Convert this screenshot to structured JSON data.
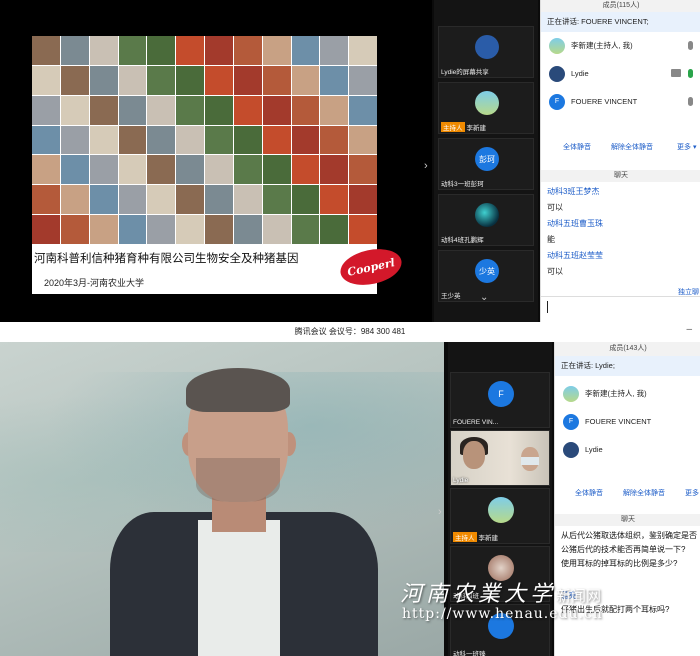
{
  "meeting": {
    "title": "腾讯会议 会议号：984 300 481"
  },
  "top": {
    "slide": {
      "title": "河南科普利信种猪育种有限公司生物安全及种猪基因",
      "date": "2020年3月-河南农业大学",
      "logo_text": "Cooperl",
      "mosaic_colors": [
        "#8a6a52",
        "#b45a3a",
        "#c9c0b4",
        "#6d8fa8",
        "#4a6b3a",
        "#d6cbb8",
        "#a33a2c",
        "#7b8a92",
        "#c8a184",
        "#5a7a4a",
        "#9a9fa6",
        "#c44c2c"
      ]
    },
    "video_tiles": [
      {
        "avatar": "",
        "caption": "Lydie的屏幕共享",
        "host": ""
      },
      {
        "avatar": "",
        "caption": "李新建",
        "host": "主持人"
      },
      {
        "avatar": "彭珂",
        "caption": "动科3一班彭珂",
        "host": ""
      },
      {
        "avatar": "",
        "caption": "动科4班孔鹏辉",
        "host": ""
      },
      {
        "avatar": "少英",
        "caption": "王少英",
        "host": ""
      }
    ],
    "members_panel": {
      "header": "成员(115人)",
      "speaking": "正在讲话: FOUERE VINCENT;",
      "members": [
        {
          "avatar": "",
          "name": "李新建(主持人, 我)"
        },
        {
          "avatar": "",
          "name": "Lydie"
        },
        {
          "avatar": "F",
          "name": "FOUERE VINCENT"
        }
      ],
      "buttons": {
        "mute_all": "全体静音",
        "unmute_all": "解除全体静音",
        "more": "更多 ▾"
      }
    },
    "chat": {
      "header": "聊天",
      "lines": [
        {
          "text": "动科3班王梦杰",
          "sender": true
        },
        {
          "text": "可以",
          "sender": false
        },
        {
          "text": "动科五班曹玉珠",
          "sender": true
        },
        {
          "text": "能",
          "sender": false
        },
        {
          "text": "动科五班赵莹莹",
          "sender": true
        },
        {
          "text": "可以",
          "sender": false
        }
      ],
      "pop_out": "独立聊"
    }
  },
  "bottom": {
    "video_tiles": [
      {
        "avatar": "F",
        "caption": "FOUERE VIN...",
        "host": ""
      },
      {
        "avatar": "",
        "caption": "Lydie",
        "host": ""
      },
      {
        "avatar": "",
        "caption": "李新建",
        "host": "主持人"
      },
      {
        "avatar": "",
        "caption": "动科四班",
        "host": ""
      },
      {
        "avatar": "",
        "caption": "动科一班臻",
        "host": ""
      }
    ],
    "members_panel": {
      "header": "成员(143人)",
      "speaking": "正在讲话: Lydie;",
      "members": [
        {
          "avatar": "",
          "name": "李新建(主持人, 我)"
        },
        {
          "avatar": "F",
          "name": "FOUERE VINCENT"
        },
        {
          "avatar": "",
          "name": "Lydie"
        }
      ],
      "buttons": {
        "mute_all": "全体静音",
        "unmute_all": "解除全体静音",
        "more": "更多"
      }
    },
    "chat": {
      "header": "聊天",
      "lines": [
        {
          "text": "从后代公猪取选体组织，鉴别确定是否",
          "sender": false
        },
        {
          "text": "公猪后代的技术能否再简单说一下?",
          "sender": false
        },
        {
          "text": "使用耳标的掉耳标的比例是多少?",
          "sender": false
        },
        {
          "text": "孟宪",
          "sender": true
        },
        {
          "text": "仔猪出生后就配打两个耳标吗?",
          "sender": false
        }
      ]
    }
  },
  "watermark": {
    "line1": "河南农業大学",
    "line1_suffix": "新闻网",
    "line2": "http://www.henau.edu.cn"
  }
}
